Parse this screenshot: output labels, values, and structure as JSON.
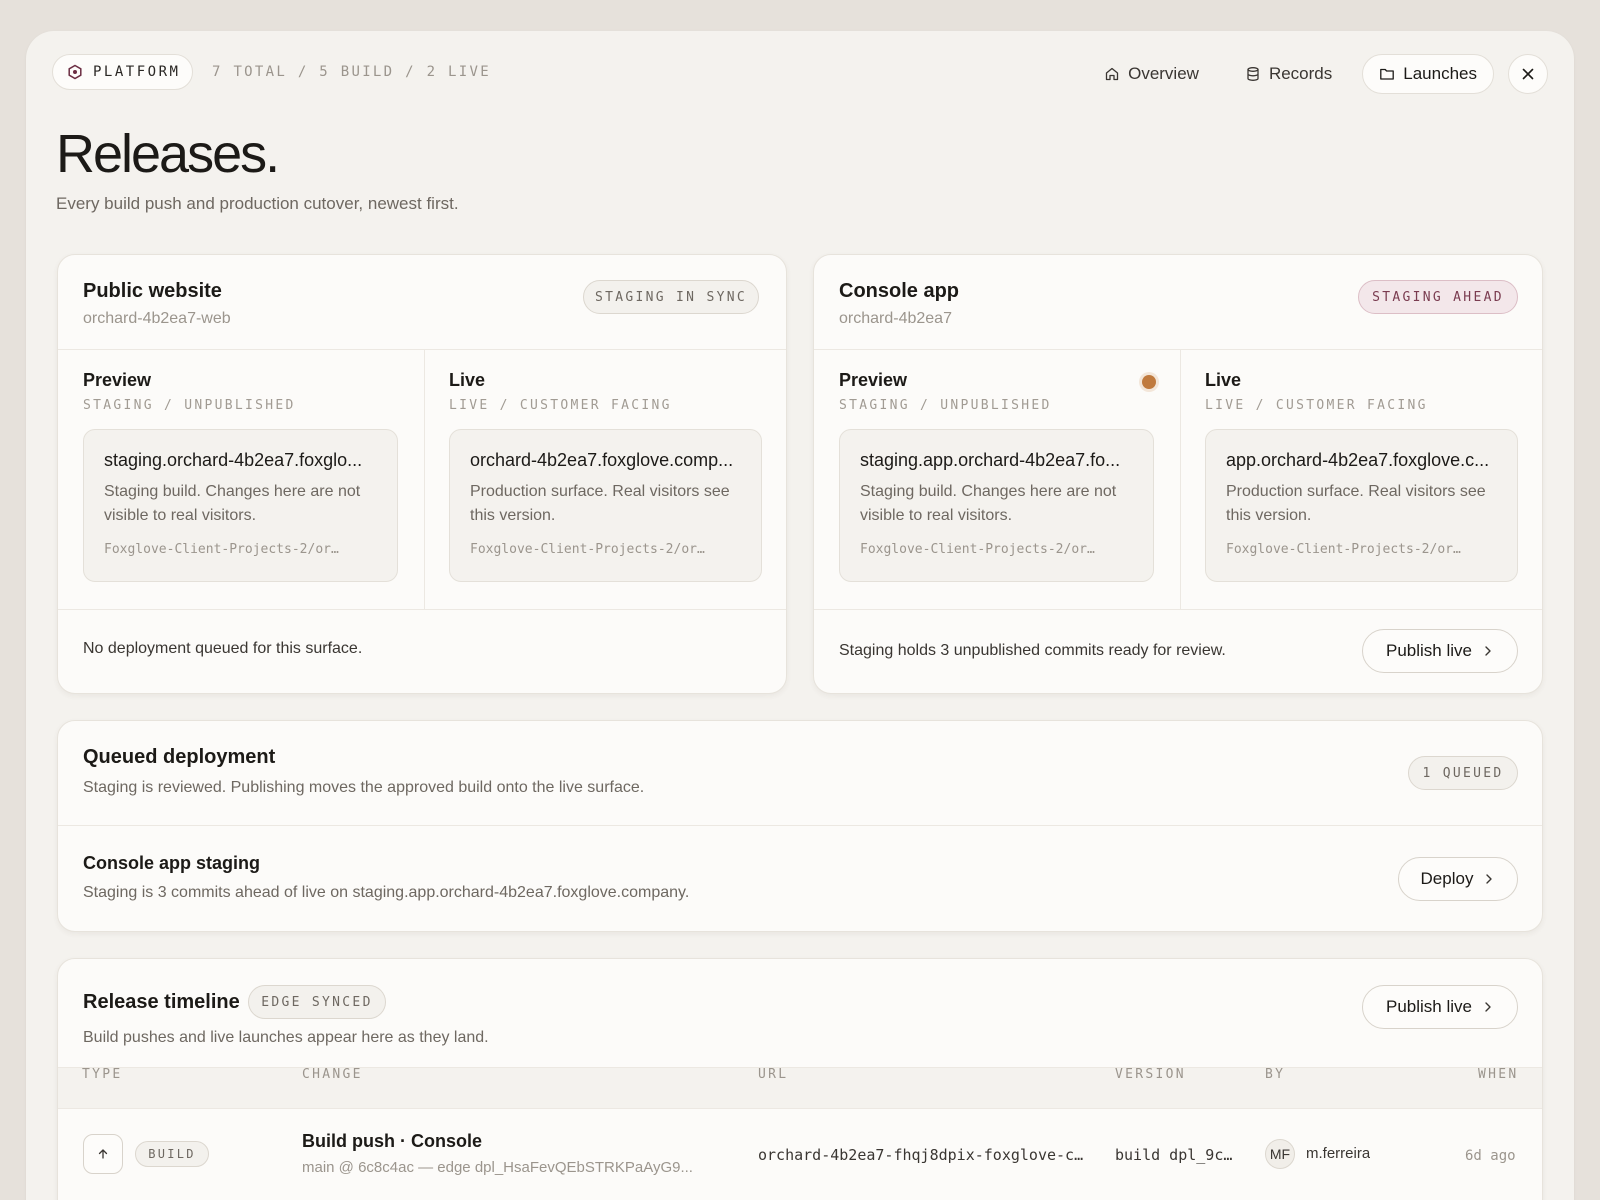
{
  "header": {
    "brand": "PLATFORM",
    "counts": "7 TOTAL / 5 BUILD / 2 LIVE",
    "nav": [
      {
        "label": "Overview",
        "icon": "home-icon"
      },
      {
        "label": "Records",
        "icon": "database-icon"
      },
      {
        "label": "Launches",
        "icon": "folder-icon",
        "active": true
      }
    ]
  },
  "page": {
    "title": "Releases.",
    "subtitle": "Every build push and production cutover, newest first."
  },
  "projects": [
    {
      "title": "Public website",
      "id": "orchard-4b2ea7-web",
      "badge": "STAGING IN SYNC",
      "preview": {
        "title": "Preview",
        "sub": "STAGING / UNPUBLISHED",
        "url": "staging.orchard-4b2ea7.foxglo...",
        "desc": "Staging build. Changes here are not visible to real visitors.",
        "path": "Foxglove-Client-Projects-2/or…"
      },
      "live": {
        "title": "Live",
        "sub": "LIVE / CUSTOMER FACING",
        "url": "orchard-4b2ea7.foxglove.comp...",
        "desc": "Production surface. Real visitors see this version.",
        "path": "Foxglove-Client-Projects-2/or…"
      },
      "footer": "No deployment queued for this surface."
    },
    {
      "title": "Console app",
      "id": "orchard-4b2ea7",
      "badge": "STAGING AHEAD",
      "preview": {
        "title": "Preview",
        "sub": "STAGING / UNPUBLISHED",
        "url": "staging.app.orchard-4b2ea7.fo...",
        "desc": "Staging build. Changes here are not visible to real visitors.",
        "path": "Foxglove-Client-Projects-2/or…"
      },
      "live": {
        "title": "Live",
        "sub": "LIVE / CUSTOMER FACING",
        "url": "app.orchard-4b2ea7.foxglove.c...",
        "desc": "Production surface. Real visitors see this version.",
        "path": "Foxglove-Client-Projects-2/or…"
      },
      "footer": "Staging holds 3 unpublished commits ready for review.",
      "button": "Publish live"
    }
  ],
  "queue": {
    "title": "Queued deployment",
    "subtitle": "Staging is reviewed. Publishing moves the approved build onto the live surface.",
    "badge": "1 QUEUED",
    "item_title": "Console app staging",
    "item_desc": "Staging is 3 commits ahead of live on staging.app.orchard-4b2ea7.foxglove.company.",
    "button": "Deploy"
  },
  "timeline": {
    "title": "Release timeline",
    "badge": "EDGE SYNCED",
    "subtitle": "Build pushes and live launches appear here as they land.",
    "button": "Publish live",
    "columns": [
      "TYPE",
      "CHANGE",
      "URL",
      "VERSION",
      "BY",
      "WHEN"
    ],
    "rows": [
      {
        "type": "BUILD",
        "change_title": "Build push · Console",
        "change_sub": "main @ 6c8c4ac — edge dpl_HsaFevQEbSTRKPaAyG9...",
        "url": "orchard-4b2ea7-fhqj8dpix-foxglove-c…",
        "version": "build dpl_9c…",
        "avatar": "MF",
        "by": "m.ferreira",
        "when": "6d ago"
      }
    ]
  },
  "colors": {
    "background": "#e6e1db",
    "surface": "#f4f2ee",
    "card": "#fcfbf9",
    "accent_dot": "#c07a3e",
    "pink_badge": "#f3e7ea"
  }
}
